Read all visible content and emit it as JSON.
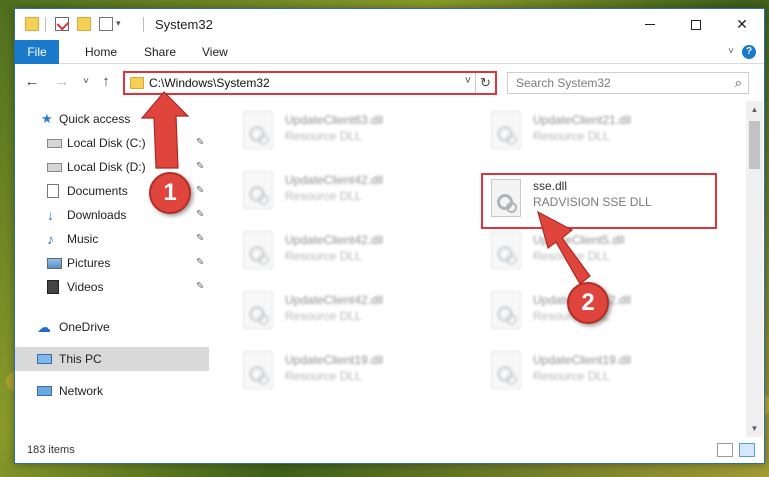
{
  "window": {
    "title": "System32",
    "minimize_glyph": "—",
    "maximize_glyph": "",
    "close_glyph": "✕"
  },
  "ribbon": {
    "tabs": [
      "File",
      "Home",
      "Share",
      "View"
    ],
    "expand_glyph": "˅",
    "help_glyph": "?"
  },
  "navigation": {
    "back_glyph": "←",
    "forward_glyph": "→",
    "recent_glyph": "˅",
    "up_glyph": "↑",
    "address": "C:\\Windows\\System32",
    "address_dropdown_glyph": "˅",
    "refresh_glyph": "↻",
    "search_placeholder": "Search System32",
    "search_glyph": "⌕"
  },
  "sidebar": {
    "items": [
      {
        "label": "Quick access",
        "icon": "star-icon"
      },
      {
        "label": "Local Disk (C:)",
        "icon": "drive-icon",
        "pinned": true
      },
      {
        "label": "Local Disk (D:)",
        "icon": "drive-icon",
        "pinned": true
      },
      {
        "label": "Documents",
        "icon": "documents-icon",
        "pinned": true
      },
      {
        "label": "Downloads",
        "icon": "downloads-icon",
        "pinned": true
      },
      {
        "label": "Music",
        "icon": "music-icon",
        "pinned": true
      },
      {
        "label": "Pictures",
        "icon": "pictures-icon",
        "pinned": true
      },
      {
        "label": "Videos",
        "icon": "videos-icon",
        "pinned": true
      },
      {
        "label": "OneDrive",
        "icon": "onedrive-icon"
      },
      {
        "label": "This PC",
        "icon": "this-pc-icon",
        "selected": true
      },
      {
        "label": "Network",
        "icon": "network-icon"
      }
    ],
    "pin_glyph": "📌"
  },
  "files": {
    "left_column": [
      {
        "name": "UpdateClient63.dll",
        "description": "Resource DLL"
      },
      {
        "name": "UpdateClient42.dll",
        "description": "Resource DLL"
      },
      {
        "name": "UpdateClient42.dll",
        "description": "Resource DLL"
      },
      {
        "name": "UpdateClient42.dll",
        "description": "Resource DLL"
      },
      {
        "name": "UpdateClient19.dll",
        "description": "Resource DLL"
      }
    ],
    "right_column": [
      {
        "name": "UpdateClient21.dll",
        "description": "Resource DLL"
      },
      {
        "name": "sse.dll",
        "description": "RADVISION SSE DLL",
        "highlighted": true
      },
      {
        "name": "UpdateClient5.dll",
        "description": "Resource DLL"
      },
      {
        "name": "UpdateClient42.dll",
        "description": "Resource DLL"
      },
      {
        "name": "UpdateClient19.dll",
        "description": "Resource DLL"
      }
    ]
  },
  "status": {
    "item_count": "183 items"
  },
  "annotations": {
    "step1": "1",
    "step2": "2"
  },
  "colors": {
    "accent": "#1979ca",
    "annotation_red": "#e0453d",
    "selected_bg": "#d9d9d9"
  }
}
